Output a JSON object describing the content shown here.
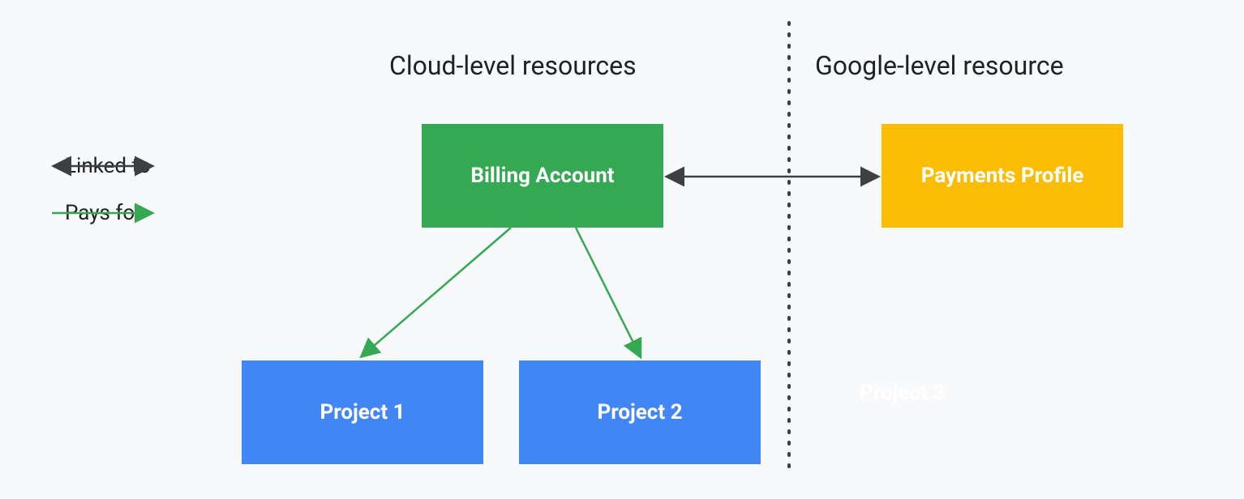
{
  "headings": {
    "cloud_level": "Cloud-level resources",
    "google_level": "Google-level resource"
  },
  "legend": {
    "linked_to": "Linked to",
    "pays_for": "Pays for"
  },
  "boxes": {
    "billing_account": "Billing Account",
    "payments_profile": "Payments Profile",
    "project1": "Project 1",
    "project2": "Project 2",
    "project3": "Project 3"
  },
  "colors": {
    "green": "#34a853",
    "yellow": "#fbbc04",
    "blue": "#4285f4",
    "dark": "#3c4043"
  }
}
